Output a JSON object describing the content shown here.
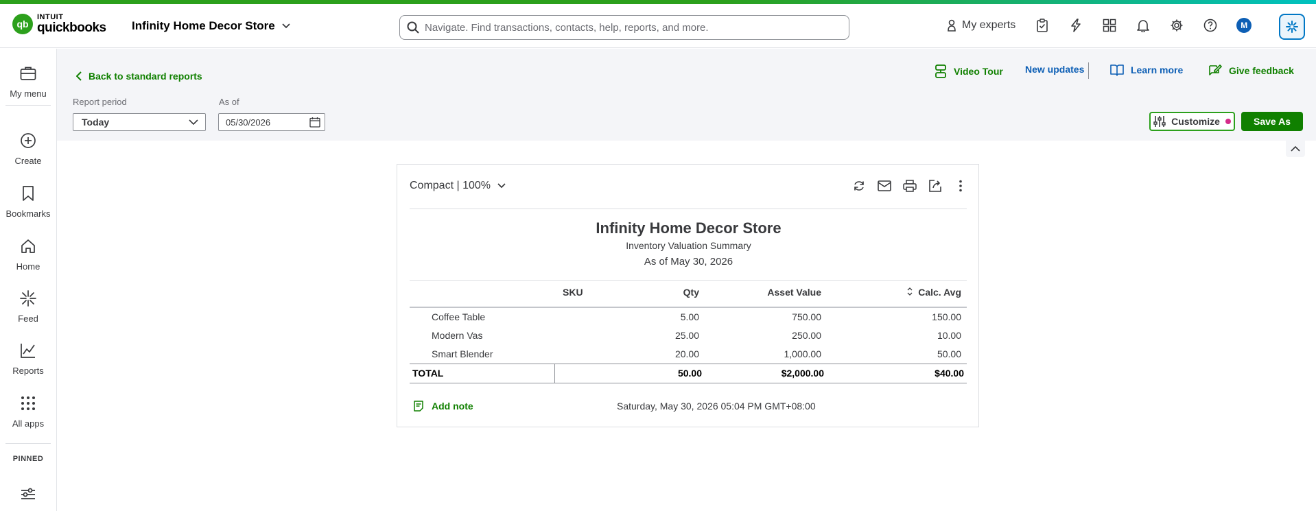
{
  "app": {
    "logo_brand": "INTUIT",
    "logo_product": "quickbooks",
    "company_name": "Infinity Home Decor Store"
  },
  "search": {
    "placeholder": "Navigate. Find transactions, contacts, help, reports, and more."
  },
  "header": {
    "experts_label": "My experts",
    "avatar_initial": "M",
    "icons": [
      "tasks-icon",
      "lightning-icon",
      "apps-icon",
      "bell-icon",
      "gear-icon",
      "help-icon"
    ]
  },
  "sidebar": {
    "items": [
      {
        "label": "My menu",
        "icon": "briefcase-icon"
      },
      {
        "label": "Create",
        "icon": "plus-circle-icon"
      },
      {
        "label": "Bookmarks",
        "icon": "bookmark-icon"
      },
      {
        "label": "Home",
        "icon": "home-icon"
      },
      {
        "label": "Feed",
        "icon": "feed-icon"
      },
      {
        "label": "Reports",
        "icon": "chart-icon"
      },
      {
        "label": "All apps",
        "icon": "grid-icon"
      }
    ],
    "pinned_label": "PINNED"
  },
  "toolbar": {
    "back_label": "Back to standard reports",
    "report_period_label": "Report period",
    "report_period_value": "Today",
    "as_of_label": "As of",
    "as_of_value": "05/30/2026",
    "video_tour": "Video Tour",
    "new_updates": "New updates",
    "learn_more": "Learn more",
    "give_feedback": "Give feedback",
    "customize": "Customize",
    "save_as": "Save As"
  },
  "report": {
    "view_label": "Compact | 100%",
    "company": "Infinity Home Decor Store",
    "title": "Inventory Valuation Summary",
    "date": "As of May 30, 2026",
    "columns": {
      "sku": "SKU",
      "qty": "Qty",
      "asset_value": "Asset Value",
      "calc_avg": "Calc. Avg"
    },
    "rows": [
      {
        "name": "Coffee Table",
        "qty": "5.00",
        "asset_value": "750.00",
        "calc_avg": "150.00"
      },
      {
        "name": "Modern Vas",
        "qty": "25.00",
        "asset_value": "250.00",
        "calc_avg": "10.00"
      },
      {
        "name": "Smart Blender",
        "qty": "20.00",
        "asset_value": "1,000.00",
        "calc_avg": "50.00"
      }
    ],
    "total": {
      "label": "TOTAL",
      "qty": "50.00",
      "asset_value": "$2,000.00",
      "calc_avg": "$40.00"
    },
    "add_note": "Add note",
    "timestamp": "Saturday, May 30, 2026 05:04 PM GMT+08:00"
  },
  "colors": {
    "brand_green": "#2ca01c",
    "link_green": "#108000",
    "link_blue": "#0077c5",
    "text": "#393a3d"
  }
}
